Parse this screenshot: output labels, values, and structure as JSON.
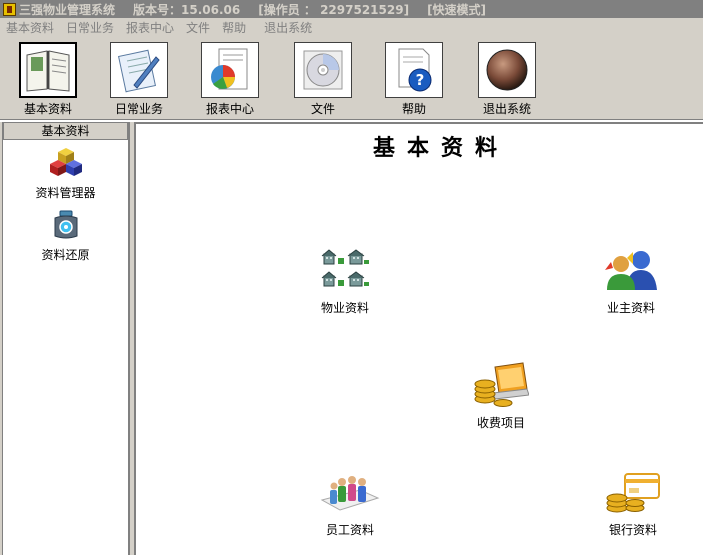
{
  "window": {
    "title": "三强物业管理系统",
    "version": "版本号：15.06.06",
    "operator": "[操作员 ： 2297521529]",
    "mode": "[快速模式]"
  },
  "menu": [
    "基本资料",
    "日常业务",
    "报表中心",
    "文件",
    "帮助",
    "退出系统"
  ],
  "toolbar": [
    {
      "label": "基本资料",
      "icon": "book-icon",
      "active": true
    },
    {
      "label": "日常业务",
      "icon": "pen-notepad-icon"
    },
    {
      "label": "报表中心",
      "icon": "pie-chart-report-icon"
    },
    {
      "label": "文件",
      "icon": "disc-icon"
    },
    {
      "label": "帮助",
      "icon": "help-icon"
    },
    {
      "label": "退出系统",
      "icon": "exit-sphere-icon"
    }
  ],
  "sidebar": {
    "header": "基本资料",
    "items": [
      {
        "label": "资料管理器",
        "icon": "cubes-icon"
      },
      {
        "label": "资料还原",
        "icon": "restore-jar-icon"
      }
    ]
  },
  "main": {
    "title": "基本资料",
    "items": [
      {
        "label": "物业资料",
        "icon": "buildings-icon"
      },
      {
        "label": "业主资料",
        "icon": "users-icon"
      },
      {
        "label": "收费项目",
        "icon": "coins-laptop-icon"
      },
      {
        "label": "员工资料",
        "icon": "staff-icon"
      },
      {
        "label": "银行资料",
        "icon": "bank-card-icon"
      }
    ]
  }
}
